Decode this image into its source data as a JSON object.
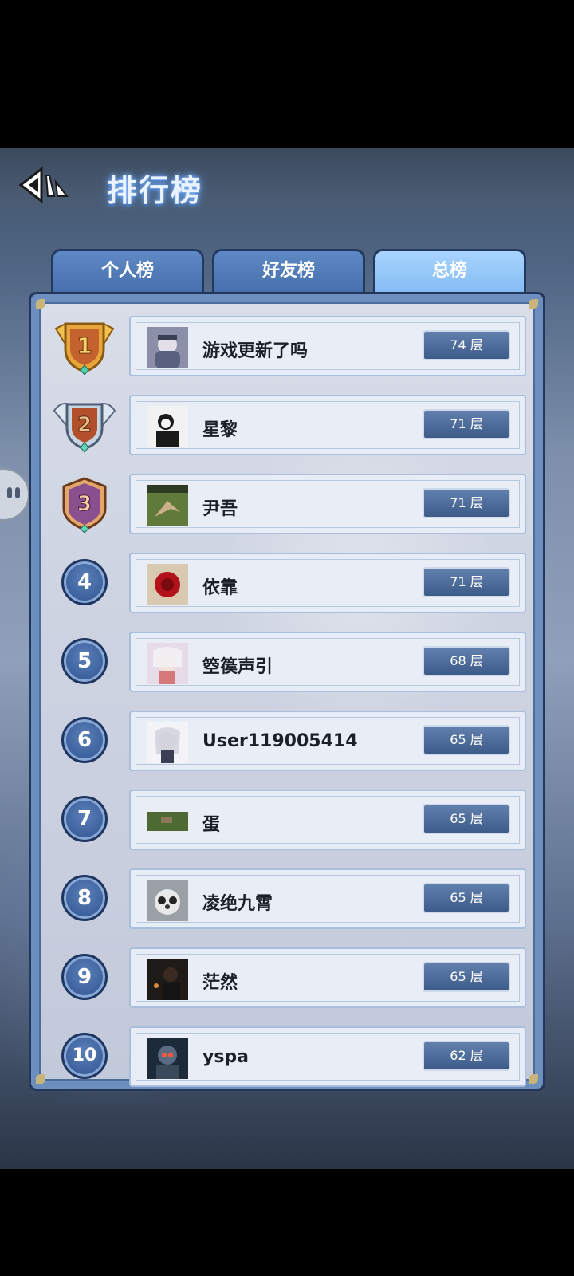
{
  "header": {
    "title": "排行榜",
    "back_icon": "back-arrow-icon"
  },
  "tabs": [
    {
      "label": "个人榜",
      "active": false
    },
    {
      "label": "好友榜",
      "active": false
    },
    {
      "label": "总榜",
      "active": true
    }
  ],
  "leaderboard": [
    {
      "rank": "1",
      "name": "游戏更新了吗",
      "score": "74 层",
      "badge": "gold-shield"
    },
    {
      "rank": "2",
      "name": "星黎",
      "score": "71 层",
      "badge": "silver-shield"
    },
    {
      "rank": "3",
      "name": "尹吾",
      "score": "71 层",
      "badge": "purple-shield"
    },
    {
      "rank": "4",
      "name": "依靠",
      "score": "71 层"
    },
    {
      "rank": "5",
      "name": "箜篌声引",
      "score": "68 层"
    },
    {
      "rank": "6",
      "name": "User119005414",
      "score": "65 层"
    },
    {
      "rank": "7",
      "name": "蛋",
      "score": "65 层"
    },
    {
      "rank": "8",
      "name": "凌绝九霄",
      "score": "65 层"
    },
    {
      "rank": "9",
      "name": "茫然",
      "score": "65 层"
    },
    {
      "rank": "10",
      "name": "yspa",
      "score": "62 层"
    }
  ],
  "colors": {
    "accent": "#4670ac",
    "active_tab": "#a8d4ff",
    "score_bg": "#3d5b89"
  }
}
